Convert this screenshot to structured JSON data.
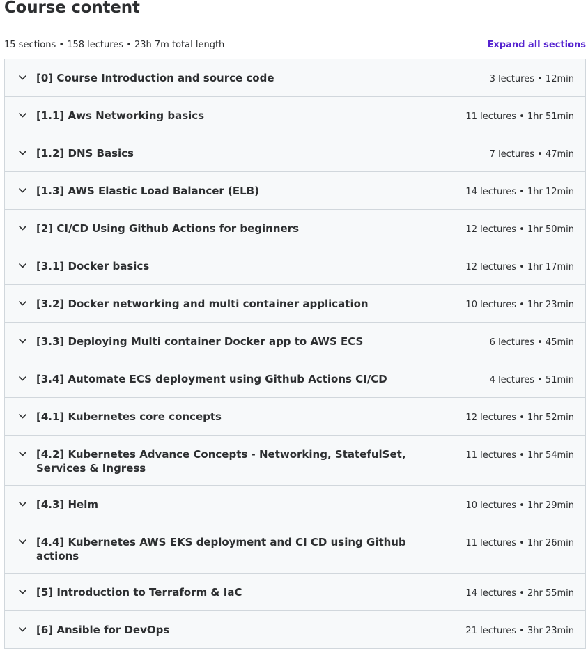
{
  "header": {
    "title": "Course content",
    "summary": "15 sections • 158 lectures • 23h 7m total length",
    "expand_all": "Expand all sections"
  },
  "sections": [
    {
      "title": "[0] Course Introduction and source code",
      "info": "3 lectures • 12min"
    },
    {
      "title": "[1.1] Aws Networking basics",
      "info": "11 lectures • 1hr 51min"
    },
    {
      "title": "[1.2] DNS Basics",
      "info": "7 lectures • 47min"
    },
    {
      "title": "[1.3] AWS Elastic Load Balancer (ELB)",
      "info": "14 lectures • 1hr 12min"
    },
    {
      "title": "[2] CI/CD Using Github Actions for beginners",
      "info": "12 lectures • 1hr 50min"
    },
    {
      "title": "[3.1] Docker basics",
      "info": "12 lectures • 1hr 17min"
    },
    {
      "title": "[3.2] Docker networking and multi container application",
      "info": "10 lectures • 1hr 23min"
    },
    {
      "title": "[3.3] Deploying Multi container Docker app to AWS ECS",
      "info": "6 lectures • 45min"
    },
    {
      "title": "[3.4] Automate ECS deployment using Github Actions CI/CD",
      "info": "4 lectures • 51min"
    },
    {
      "title": "[4.1] Kubernetes core concepts",
      "info": "12 lectures • 1hr 52min"
    },
    {
      "title": "[4.2] Kubernetes Advance Concepts - Networking, StatefulSet, Services & Ingress",
      "info": "11 lectures • 1hr 54min"
    },
    {
      "title": "[4.3] Helm",
      "info": "10 lectures • 1hr 29min"
    },
    {
      "title": "[4.4] Kubernetes AWS EKS deployment and CI CD using Github actions",
      "info": "11 lectures • 1hr 26min"
    },
    {
      "title": "[5] Introduction to Terraform & IaC",
      "info": "14 lectures • 2hr 55min"
    },
    {
      "title": "[6] Ansible for DevOps",
      "info": "21 lectures • 3hr 23min"
    }
  ],
  "icons": {
    "section_toggle": "chevron-down-icon"
  },
  "colors": {
    "accent": "#5624d0",
    "section_bg": "#f7f9fa",
    "border": "#d1d7dc",
    "text": "#2d2f31"
  }
}
